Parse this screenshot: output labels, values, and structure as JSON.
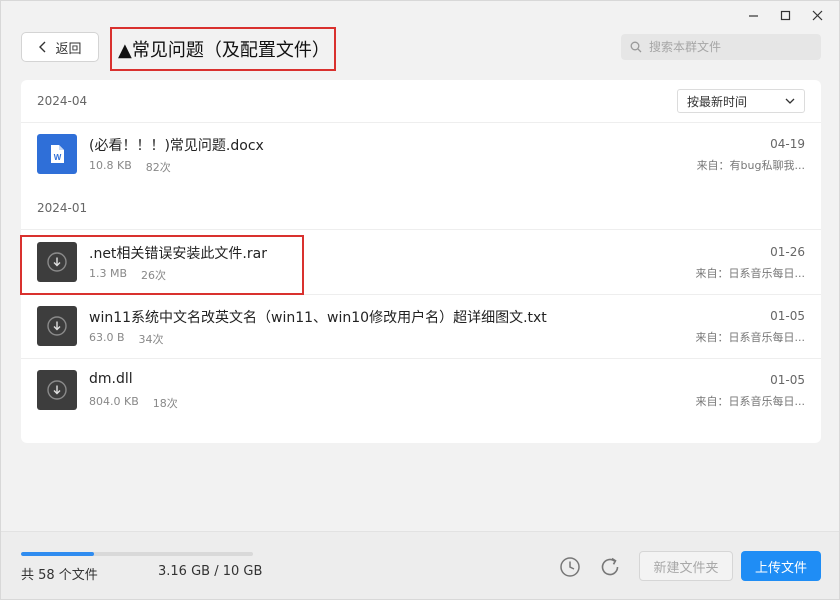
{
  "window": {
    "controls": [
      "minimize-icon",
      "maximize-icon",
      "close-icon"
    ]
  },
  "header": {
    "back_label": "返回",
    "title": "▲常见问题（及配置文件）",
    "search_placeholder": "搜索本群文件"
  },
  "list": {
    "sort_label": "按最新时间",
    "groups": [
      {
        "label": "2024-04",
        "files": [
          {
            "name": "(必看！！！)常见问题.docx",
            "size": "10.8 KB",
            "downloads": "82次",
            "date": "04-19",
            "source": "来自：有bug私聊我...",
            "icon": "word-doc-icon"
          }
        ]
      },
      {
        "label": "2024-01",
        "files": [
          {
            "name": ".net相关错误安装此文件.rar",
            "size": "1.3 MB",
            "downloads": "26次",
            "date": "01-26",
            "source": "来自：日系音乐每日...",
            "icon": "download-file-icon"
          },
          {
            "name": "win11系统中文名改英文名（win11、win10修改用户名）超详细图文.txt",
            "size": "63.0 B",
            "downloads": "34次",
            "date": "01-05",
            "source": "来自：日系音乐每日...",
            "icon": "download-file-icon"
          },
          {
            "name": "dm.dll",
            "size": "804.0 KB",
            "downloads": "18次",
            "date": "01-05",
            "source": "来自：日系音乐每日...",
            "icon": "download-file-icon"
          }
        ]
      }
    ]
  },
  "footer": {
    "file_count": "共 58 个文件",
    "usage": "3.16 GB / 10 GB",
    "usage_fraction": 0.316,
    "new_folder_label": "新建文件夹",
    "upload_label": "上传文件"
  },
  "colors": {
    "accent": "#1f8df5",
    "highlight": "#d9312e",
    "word_icon": "#2f6fd8",
    "file_icon": "#3d3d3d"
  }
}
